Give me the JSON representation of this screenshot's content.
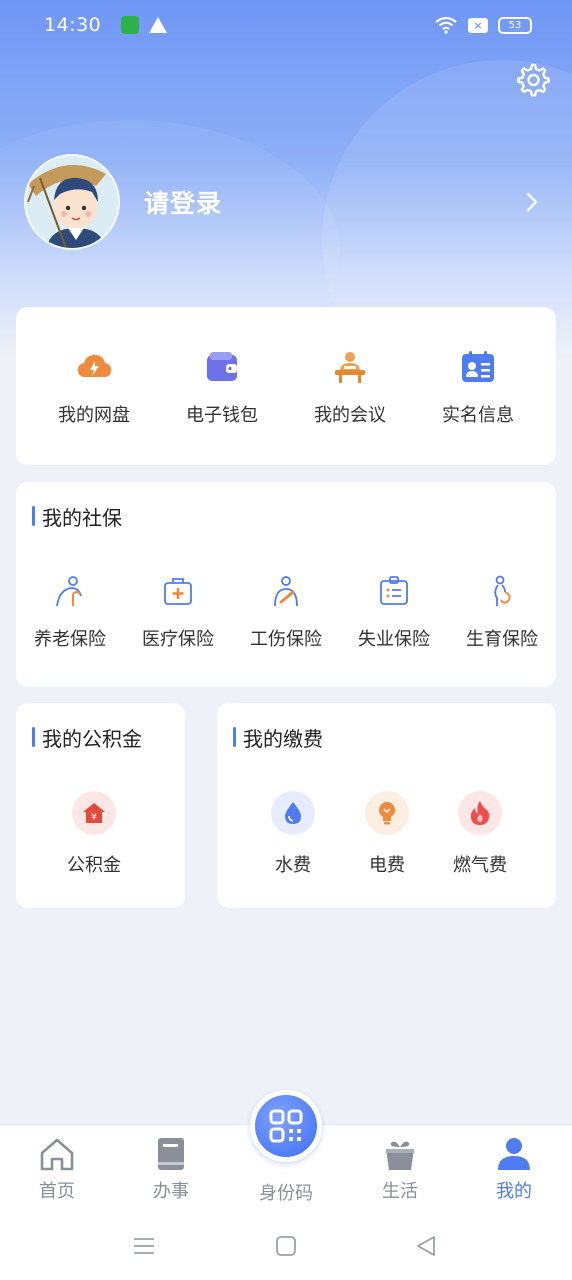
{
  "status_bar": {
    "time": "14:30",
    "battery": "53"
  },
  "profile": {
    "login_label": "请登录"
  },
  "quick_actions": [
    {
      "label": "我的网盘",
      "icon": "cloud-icon"
    },
    {
      "label": "电子钱包",
      "icon": "wallet-icon"
    },
    {
      "label": "我的会议",
      "icon": "meeting-icon"
    },
    {
      "label": "实名信息",
      "icon": "id-card-icon"
    }
  ],
  "social": {
    "title": "我的社保",
    "items": [
      {
        "label": "养老保险",
        "icon": "elderly-icon"
      },
      {
        "label": "医疗保险",
        "icon": "medical-kit-icon"
      },
      {
        "label": "工伤保险",
        "icon": "injury-icon"
      },
      {
        "label": "失业保险",
        "icon": "badge-icon"
      },
      {
        "label": "生育保险",
        "icon": "pregnancy-icon"
      }
    ]
  },
  "fund": {
    "title": "我的公积金",
    "item_label": "公积金"
  },
  "payment": {
    "title": "我的缴费",
    "items": [
      {
        "label": "水费",
        "icon": "water-drop-icon",
        "color": "#4f7cf0"
      },
      {
        "label": "电费",
        "icon": "bulb-icon",
        "color": "#f08a3c"
      },
      {
        "label": "燃气费",
        "icon": "flame-icon",
        "color": "#f04d4d"
      }
    ]
  },
  "tabbar": [
    {
      "label": "首页",
      "icon": "home-icon"
    },
    {
      "label": "办事",
      "icon": "book-icon"
    },
    {
      "label": "身份码",
      "icon": "qr-code-icon"
    },
    {
      "label": "生活",
      "icon": "gift-icon"
    },
    {
      "label": "我的",
      "icon": "user-icon",
      "active": true
    }
  ],
  "colors": {
    "accent": "#4f7cf0",
    "hero_top": "#6f96f5",
    "orange": "#f08a3c"
  }
}
